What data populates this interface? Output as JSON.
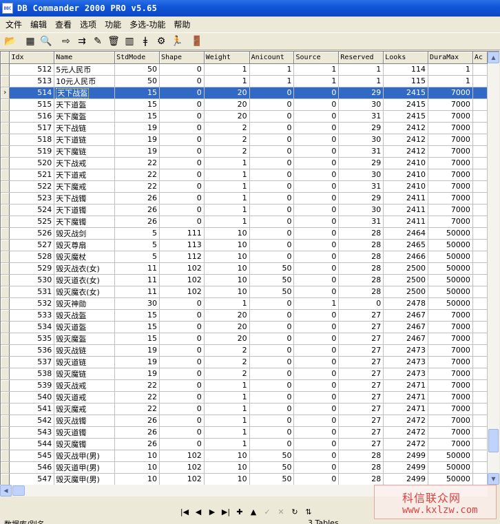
{
  "window": {
    "title": "DB Commander 2000 PRO v5.65",
    "icon_text": "DBC"
  },
  "menu": [
    "文件",
    "编辑",
    "查看",
    "选项",
    "功能",
    "多选-功能",
    "帮助"
  ],
  "toolbar": {
    "buttons": [
      {
        "name": "open-folder-icon",
        "glyph": "📂"
      },
      {
        "name": "table-grid-icon",
        "glyph": "▦"
      },
      {
        "name": "sql-query-icon",
        "glyph": "🔍"
      },
      {
        "name": "arrow-right-icon",
        "glyph": "⇨"
      },
      {
        "name": "export-icon",
        "glyph": "⇉"
      },
      {
        "name": "edit-pencil-icon",
        "glyph": "✎"
      },
      {
        "name": "trash-icon",
        "glyph": "🗑"
      },
      {
        "name": "database-icon",
        "glyph": "▥"
      },
      {
        "name": "info-bookmark-icon",
        "glyph": "ǂ"
      },
      {
        "name": "search-tools-icon",
        "glyph": "⚙"
      },
      {
        "name": "runner-icon",
        "glyph": "🏃"
      },
      {
        "name": "exit-door-icon",
        "glyph": "🚪"
      }
    ]
  },
  "grid": {
    "columns": [
      "Idx",
      "Name",
      "StdMode",
      "Shape",
      "Weight",
      "Anicount",
      "Source",
      "Reserved",
      "Looks",
      "DuraMax",
      "Ac"
    ],
    "selected_indicator": "›",
    "rows": [
      [
        "512",
        "5元人民币",
        "50",
        "0",
        "1",
        "1",
        "1",
        "1",
        "114",
        "1",
        ""
      ],
      [
        "513",
        "10元人民币",
        "50",
        "0",
        "1",
        "1",
        "1",
        "1",
        "115",
        "1",
        ""
      ],
      [
        "514",
        "天下战盔",
        "15",
        "0",
        "20",
        "0",
        "0",
        "29",
        "2415",
        "7000",
        ""
      ],
      [
        "515",
        "天下道盔",
        "15",
        "0",
        "20",
        "0",
        "0",
        "30",
        "2415",
        "7000",
        ""
      ],
      [
        "516",
        "天下魔盔",
        "15",
        "0",
        "20",
        "0",
        "0",
        "31",
        "2415",
        "7000",
        ""
      ],
      [
        "517",
        "天下战链",
        "19",
        "0",
        "2",
        "0",
        "0",
        "29",
        "2412",
        "7000",
        ""
      ],
      [
        "518",
        "天下道链",
        "19",
        "0",
        "2",
        "0",
        "0",
        "30",
        "2412",
        "7000",
        ""
      ],
      [
        "519",
        "天下魔链",
        "19",
        "0",
        "2",
        "0",
        "0",
        "31",
        "2412",
        "7000",
        ""
      ],
      [
        "520",
        "天下战戒",
        "22",
        "0",
        "1",
        "0",
        "0",
        "29",
        "2410",
        "7000",
        ""
      ],
      [
        "521",
        "天下道戒",
        "22",
        "0",
        "1",
        "0",
        "0",
        "30",
        "2410",
        "7000",
        ""
      ],
      [
        "522",
        "天下魔戒",
        "22",
        "0",
        "1",
        "0",
        "0",
        "31",
        "2410",
        "7000",
        ""
      ],
      [
        "523",
        "天下战镯",
        "26",
        "0",
        "1",
        "0",
        "0",
        "29",
        "2411",
        "7000",
        ""
      ],
      [
        "524",
        "天下道镯",
        "26",
        "0",
        "1",
        "0",
        "0",
        "30",
        "2411",
        "7000",
        ""
      ],
      [
        "525",
        "天下魔镯",
        "26",
        "0",
        "1",
        "0",
        "0",
        "31",
        "2411",
        "7000",
        ""
      ],
      [
        "526",
        "毁灭战剑",
        "5",
        "111",
        "10",
        "0",
        "0",
        "28",
        "2464",
        "50000",
        ""
      ],
      [
        "527",
        "毁灭尊扇",
        "5",
        "113",
        "10",
        "0",
        "0",
        "28",
        "2465",
        "50000",
        ""
      ],
      [
        "528",
        "毁灭魔杖",
        "5",
        "112",
        "10",
        "0",
        "0",
        "28",
        "2466",
        "50000",
        ""
      ],
      [
        "529",
        "毁灭战衣(女)",
        "11",
        "102",
        "10",
        "50",
        "0",
        "28",
        "2500",
        "50000",
        ""
      ],
      [
        "530",
        "毁灭道衣(女)",
        "11",
        "102",
        "10",
        "50",
        "0",
        "28",
        "2500",
        "50000",
        ""
      ],
      [
        "531",
        "毁灭魔衣(女)",
        "11",
        "102",
        "10",
        "50",
        "0",
        "28",
        "2500",
        "50000",
        ""
      ],
      [
        "532",
        "毁灭神勋",
        "30",
        "0",
        "1",
        "0",
        "1",
        "0",
        "2478",
        "50000",
        ""
      ],
      [
        "533",
        "毁灭战盔",
        "15",
        "0",
        "20",
        "0",
        "0",
        "27",
        "2467",
        "7000",
        ""
      ],
      [
        "534",
        "毁灭道盔",
        "15",
        "0",
        "20",
        "0",
        "0",
        "27",
        "2467",
        "7000",
        ""
      ],
      [
        "535",
        "毁灭魔盔",
        "15",
        "0",
        "20",
        "0",
        "0",
        "27",
        "2467",
        "7000",
        ""
      ],
      [
        "536",
        "毁灭战链",
        "19",
        "0",
        "2",
        "0",
        "0",
        "27",
        "2473",
        "7000",
        ""
      ],
      [
        "537",
        "毁灭道链",
        "19",
        "0",
        "2",
        "0",
        "0",
        "27",
        "2473",
        "7000",
        ""
      ],
      [
        "538",
        "毁灭魔链",
        "19",
        "0",
        "2",
        "0",
        "0",
        "27",
        "2473",
        "7000",
        ""
      ],
      [
        "539",
        "毁灭战戒",
        "22",
        "0",
        "1",
        "0",
        "0",
        "27",
        "2471",
        "7000",
        ""
      ],
      [
        "540",
        "毁灭道戒",
        "22",
        "0",
        "1",
        "0",
        "0",
        "27",
        "2471",
        "7000",
        ""
      ],
      [
        "541",
        "毁灭魔戒",
        "22",
        "0",
        "1",
        "0",
        "0",
        "27",
        "2471",
        "7000",
        ""
      ],
      [
        "542",
        "毁灭战镯",
        "26",
        "0",
        "1",
        "0",
        "0",
        "27",
        "2472",
        "7000",
        ""
      ],
      [
        "543",
        "毁灭道镯",
        "26",
        "0",
        "1",
        "0",
        "0",
        "27",
        "2472",
        "7000",
        ""
      ],
      [
        "544",
        "毁灭魔镯",
        "26",
        "0",
        "1",
        "0",
        "0",
        "27",
        "2472",
        "7000",
        ""
      ],
      [
        "545",
        "毁灭战甲(男)",
        "10",
        "102",
        "10",
        "50",
        "0",
        "28",
        "2499",
        "50000",
        ""
      ],
      [
        "546",
        "毁灭道甲(男)",
        "10",
        "102",
        "10",
        "50",
        "0",
        "28",
        "2499",
        "50000",
        ""
      ],
      [
        "547",
        "毁灭魔甲(男)",
        "10",
        "102",
        "10",
        "50",
        "0",
        "28",
        "2499",
        "50000",
        ""
      ]
    ],
    "selected_row": 2
  },
  "navigator": [
    {
      "name": "nav-first-button",
      "glyph": "|◀",
      "enabled": true
    },
    {
      "name": "nav-prior-button",
      "glyph": "◀",
      "enabled": true
    },
    {
      "name": "nav-next-button",
      "glyph": "▶",
      "enabled": true
    },
    {
      "name": "nav-last-button",
      "glyph": "▶|",
      "enabled": true
    },
    {
      "name": "nav-insert-button",
      "glyph": "✚",
      "enabled": true
    },
    {
      "name": "nav-delete-button",
      "glyph": "▲",
      "enabled": true
    },
    {
      "name": "nav-edit-button",
      "glyph": "✓",
      "enabled": false
    },
    {
      "name": "nav-post-button",
      "glyph": "✕",
      "enabled": false
    },
    {
      "name": "nav-refresh-button",
      "glyph": "↻",
      "enabled": true
    },
    {
      "name": "nav-filter-button",
      "glyph": "⇅",
      "enabled": true
    }
  ],
  "watermark": {
    "line1": "科信联众网",
    "line2": "www.kxlzw.com"
  },
  "status": {
    "left": "数据库/别名",
    "right": "3 Tables"
  }
}
